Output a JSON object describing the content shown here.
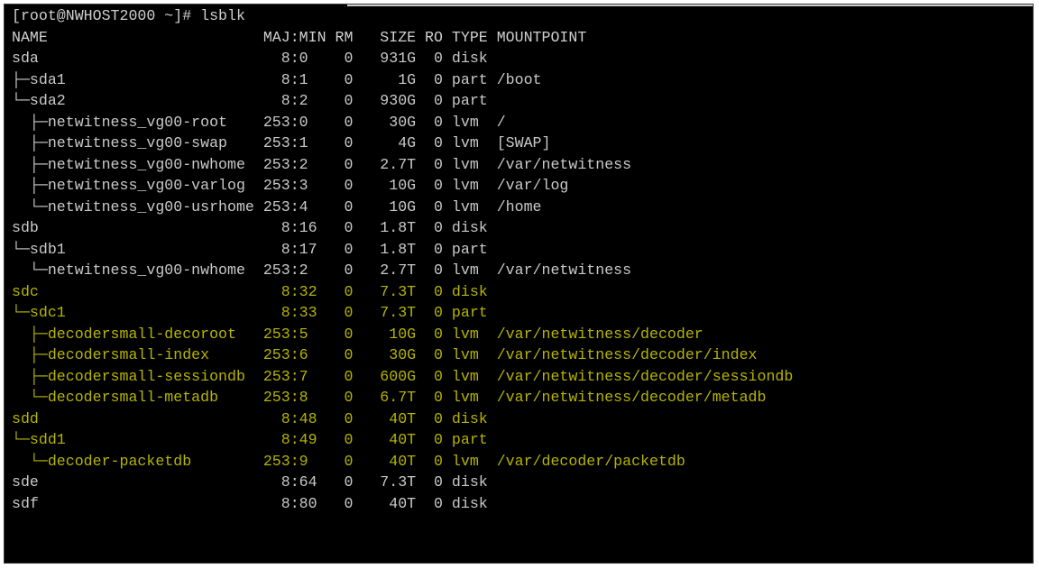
{
  "terminal": {
    "prompt": "[root@NWHOST2000 ~]# lsblk",
    "header": "NAME                        MAJ:MIN RM   SIZE RO TYPE MOUNTPOINT",
    "colors": {
      "default_text": "#c9c9c9",
      "highlight_text": "#b6b400",
      "background": "#000000"
    },
    "rows": [
      {
        "text": "sda                           8:0    0   931G  0 disk",
        "color": "gray"
      },
      {
        "text": "├─sda1                        8:1    0     1G  0 part /boot",
        "color": "gray"
      },
      {
        "text": "└─sda2                        8:2    0   930G  0 part",
        "color": "gray"
      },
      {
        "text": "  ├─netwitness_vg00-root    253:0    0    30G  0 lvm  /",
        "color": "gray"
      },
      {
        "text": "  ├─netwitness_vg00-swap    253:1    0     4G  0 lvm  [SWAP]",
        "color": "gray"
      },
      {
        "text": "  ├─netwitness_vg00-nwhome  253:2    0   2.7T  0 lvm  /var/netwitness",
        "color": "gray"
      },
      {
        "text": "  ├─netwitness_vg00-varlog  253:3    0    10G  0 lvm  /var/log",
        "color": "gray"
      },
      {
        "text": "  └─netwitness_vg00-usrhome 253:4    0    10G  0 lvm  /home",
        "color": "gray"
      },
      {
        "text": "sdb                           8:16   0   1.8T  0 disk",
        "color": "gray"
      },
      {
        "text": "└─sdb1                        8:17   0   1.8T  0 part",
        "color": "gray"
      },
      {
        "text": "  └─netwitness_vg00-nwhome  253:2    0   2.7T  0 lvm  /var/netwitness",
        "color": "gray"
      },
      {
        "text": "sdc                           8:32   0   7.3T  0 disk",
        "color": "yellow"
      },
      {
        "text": "└─sdc1                        8:33   0   7.3T  0 part",
        "color": "yellow"
      },
      {
        "text": "  ├─decodersmall-decoroot   253:5    0    10G  0 lvm  /var/netwitness/decoder",
        "color": "yellow"
      },
      {
        "text": "  ├─decodersmall-index      253:6    0    30G  0 lvm  /var/netwitness/decoder/index",
        "color": "yellow"
      },
      {
        "text": "  ├─decodersmall-sessiondb  253:7    0   600G  0 lvm  /var/netwitness/decoder/sessiondb",
        "color": "yellow"
      },
      {
        "text": "  └─decodersmall-metadb     253:8    0   6.7T  0 lvm  /var/netwitness/decoder/metadb",
        "color": "yellow"
      },
      {
        "text": "sdd                           8:48   0    40T  0 disk",
        "color": "yellow"
      },
      {
        "text": "└─sdd1                        8:49   0    40T  0 part",
        "color": "yellow"
      },
      {
        "text": "  └─decoder-packetdb        253:9    0    40T  0 lvm  /var/decoder/packetdb",
        "color": "yellow"
      },
      {
        "text": "sde                           8:64   0   7.3T  0 disk",
        "color": "gray"
      },
      {
        "text": "sdf                           8:80   0    40T  0 disk",
        "color": "gray"
      }
    ]
  }
}
